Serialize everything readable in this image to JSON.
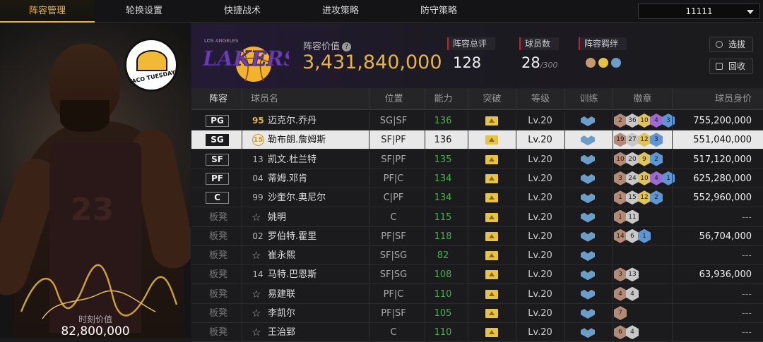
{
  "tabs": [
    {
      "label": "阵容管理",
      "active": true
    },
    {
      "label": "轮换设置",
      "active": false
    },
    {
      "label": "快捷战术",
      "active": false
    },
    {
      "label": "进攻策略",
      "active": false
    },
    {
      "label": "防守策略",
      "active": false
    }
  ],
  "dropdown": {
    "value": "11111"
  },
  "card": {
    "sticker_text": "TACO TUESDAY",
    "jersey_number": "23",
    "moment_value_label": "时刻价值",
    "moment_value": "82,800,000"
  },
  "summary": {
    "team_logo_text": "LAKERS",
    "team_logo_subtext": "LOS ANGELES",
    "lineup_value_label": "阵容价值",
    "lineup_value": "3,431,840,000",
    "rating_label": "阵容总评",
    "rating_value": "128",
    "player_count_label": "球员数",
    "player_count_value": "28",
    "player_count_max": "/300",
    "bond_label": "阵容羁绊",
    "select_button": "选拔",
    "recycle_button": "回收"
  },
  "columns": {
    "lineup": "阵容",
    "player": "球员名",
    "position": "位置",
    "ability": "能力",
    "breakthrough": "突破",
    "level": "等级",
    "training": "训练",
    "badges": "徽章",
    "value": "球员身价"
  },
  "rows": [
    {
      "slot": "PG",
      "num": "95",
      "num_style": "gold",
      "name": "迈克尔.乔丹",
      "pos": "SG|SF",
      "ability": "136",
      "level": "Lv.20",
      "badges": [
        [
          "bronze",
          "2"
        ],
        [
          "silver",
          "36"
        ],
        [
          "gold",
          "10"
        ],
        [
          "purple",
          "4"
        ],
        [
          "blue",
          "3"
        ]
      ],
      "value": "755,200,000"
    },
    {
      "slot": "SG",
      "num": "15",
      "num_style": "circ",
      "name": "勒布朗.詹姆斯",
      "pos": "SF|PF",
      "ability": "136",
      "level": "Lv.20",
      "badges": [
        [
          "bronze",
          "19"
        ],
        [
          "silver",
          "27"
        ],
        [
          "gold",
          "12"
        ],
        [
          "blue",
          "3"
        ]
      ],
      "value": "551,040,000",
      "selected": true
    },
    {
      "slot": "SF",
      "num": "13",
      "num_style": "plain",
      "name": "凯文.杜兰特",
      "pos": "SF|PF",
      "ability": "135",
      "level": "Lv.20",
      "badges": [
        [
          "bronze",
          "10"
        ],
        [
          "silver",
          "20"
        ],
        [
          "gold",
          "9"
        ],
        [
          "blue",
          "2"
        ]
      ],
      "value": "517,120,000"
    },
    {
      "slot": "PF",
      "num": "04",
      "num_style": "plain",
      "name": "蒂姆.邓肯",
      "pos": "PF|C",
      "ability": "134",
      "level": "Lv.20",
      "badges": [
        [
          "bronze",
          "3"
        ],
        [
          "silver",
          "24"
        ],
        [
          "gold",
          "10"
        ],
        [
          "purple",
          "4"
        ],
        [
          "blue",
          "1"
        ]
      ],
      "value": "625,280,000"
    },
    {
      "slot": "C",
      "num": "99",
      "num_style": "plain",
      "name": "沙奎尔.奥尼尔",
      "pos": "C|PF",
      "ability": "134",
      "level": "Lv.20",
      "badges": [
        [
          "bronze",
          "1"
        ],
        [
          "silver",
          "15"
        ],
        [
          "gold",
          "12"
        ],
        [
          "blue",
          "2"
        ]
      ],
      "value": "552,960,000"
    },
    {
      "slot": "板凳",
      "num": "☆",
      "num_style": "star",
      "name": "姚明",
      "pos": "C",
      "ability": "115",
      "level": "Lv.20",
      "badges": [
        [
          "bronze",
          "1"
        ],
        [
          "silver",
          "11"
        ]
      ],
      "value": "---"
    },
    {
      "slot": "板凳",
      "num": "02",
      "num_style": "plain",
      "name": "罗伯特.霍里",
      "pos": "PF|SF",
      "ability": "118",
      "level": "Lv.20",
      "badges": [
        [
          "bronze",
          "14"
        ],
        [
          "silver",
          "6"
        ],
        [
          "blue",
          "1"
        ]
      ],
      "value": "56,704,000"
    },
    {
      "slot": "板凳",
      "num": "☆",
      "num_style": "star",
      "name": "崔永熙",
      "pos": "SF|SG",
      "ability": "82",
      "level": "Lv.20",
      "badges": [],
      "value": "---"
    },
    {
      "slot": "板凳",
      "num": "14",
      "num_style": "plain",
      "name": "马特.巴恩斯",
      "pos": "SF|SG",
      "ability": "108",
      "level": "Lv.20",
      "badges": [
        [
          "bronze",
          "3"
        ],
        [
          "silver",
          "13"
        ]
      ],
      "value": "63,936,000"
    },
    {
      "slot": "板凳",
      "num": "☆",
      "num_style": "star",
      "name": "易建联",
      "pos": "PF|C",
      "ability": "110",
      "level": "Lv.20",
      "badges": [
        [
          "bronze",
          "4"
        ],
        [
          "silver",
          "4"
        ]
      ],
      "value": "---"
    },
    {
      "slot": "板凳",
      "num": "☆",
      "num_style": "star",
      "name": "李凯尔",
      "pos": "PF|SF",
      "ability": "105",
      "level": "Lv.20",
      "badges": [
        [
          "bronze",
          "7"
        ]
      ],
      "value": "---"
    },
    {
      "slot": "板凳",
      "num": "☆",
      "num_style": "star",
      "name": "王治郅",
      "pos": "C",
      "ability": "110",
      "level": "Lv.20",
      "badges": [
        [
          "bronze",
          "6"
        ],
        [
          "silver",
          "4"
        ]
      ],
      "value": "---"
    }
  ]
}
